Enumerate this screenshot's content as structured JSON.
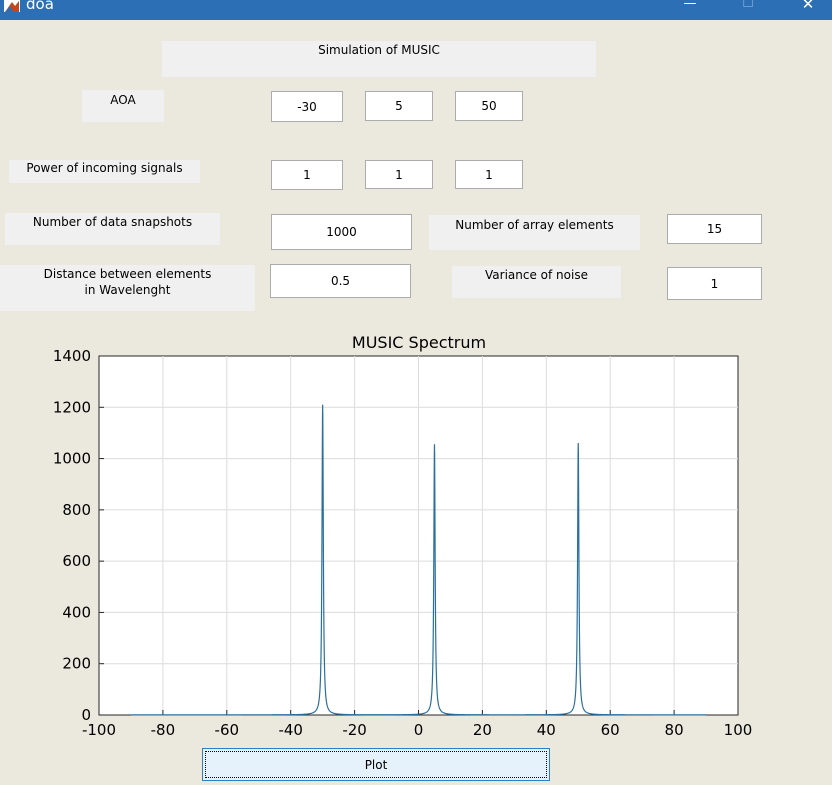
{
  "window": {
    "title": "doa",
    "minimize_glyph": "—",
    "maximize_glyph": "☐",
    "close_glyph": "✕"
  },
  "panel": {
    "title": "Simulation of MUSIC",
    "aoa_label": "AOA",
    "aoa_values": [
      "-30",
      "5",
      "50"
    ],
    "power_label": "Power of incoming signals",
    "power_values": [
      "1",
      "1",
      "1"
    ],
    "snapshots_label": "Number of data snapshots",
    "snapshots_value": "1000",
    "array_label": "Number of array elements",
    "array_value": "15",
    "distance_label_line1": "Distance between elements",
    "distance_label_line2": "in Wavelenght",
    "distance_value": "0.5",
    "noise_label": "Variance of noise",
    "noise_value": "1"
  },
  "plot_button_label": "Plot",
  "chart_data": {
    "type": "line",
    "title": "MUSIC Spectrum",
    "xlabel": "",
    "ylabel": "",
    "xlim": [
      -100,
      100
    ],
    "ylim": [
      0,
      1400
    ],
    "x_ticks": [
      -100,
      -80,
      -60,
      -40,
      -20,
      0,
      20,
      40,
      60,
      80,
      100
    ],
    "y_ticks": [
      0,
      200,
      400,
      600,
      800,
      1000,
      1200,
      1400
    ],
    "grid": true,
    "line_color": "#2a6f9e",
    "x_range_of_series": [
      -90,
      90
    ],
    "peaks": [
      {
        "x": -30,
        "y": 1210
      },
      {
        "x": 5,
        "y": 1055
      },
      {
        "x": 50,
        "y": 1060
      }
    ]
  }
}
